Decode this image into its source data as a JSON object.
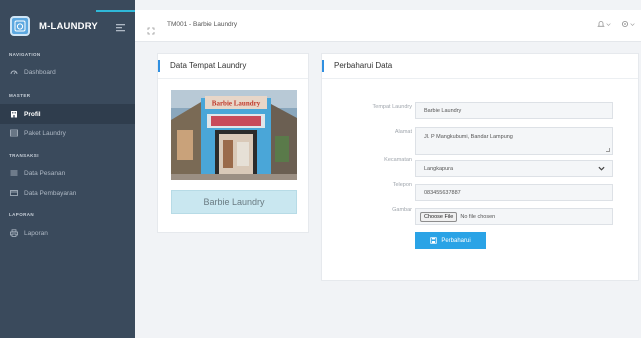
{
  "app": {
    "brand": "M-LAUNDRY"
  },
  "sidebar": {
    "sections": {
      "navigation": "NAVIGATION",
      "master": "MASTER",
      "transaksi": "TRANSAKSI",
      "laporan": "LAPORAN"
    },
    "items": [
      {
        "label": "Dashboard",
        "icon": "dashboard-icon"
      },
      {
        "label": "Profil",
        "icon": "building-icon",
        "active": true
      },
      {
        "label": "Paket Laundry",
        "icon": "table-icon"
      },
      {
        "label": "Data Pesanan",
        "icon": "list-icon"
      },
      {
        "label": "Data Pembayaran",
        "icon": "card-icon"
      },
      {
        "label": "Laporan",
        "icon": "print-icon"
      }
    ]
  },
  "header": {
    "breadcrumb": "TM001 - Barbie Laundry"
  },
  "left_card": {
    "title": "Data Tempat Laundry",
    "laundry_name": "Barbie Laundry",
    "photo_sign_text": "Barbie Laundry"
  },
  "right_card": {
    "title": "Perbaharui Data",
    "fields": {
      "tempat_label": "Tempat Laundry",
      "tempat_value": "Barbie Laundry",
      "alamat_label": "Alamat",
      "alamat_value": "Jl. P Mangkubumi, Bandar Lampung",
      "kecamatan_label": "Kecamatan",
      "kecamatan_value": "Langkapura",
      "telepon_label": "Telepon",
      "telepon_value": "083455637887",
      "gambar_label": "Gambar",
      "file_button": "Choose File",
      "file_status": "No file chosen"
    },
    "submit_label": "Perbaharui"
  },
  "colors": {
    "sidebar": "#3a4a5c",
    "sidebar_active": "#2f3d4d",
    "accent": "#2aa3e6",
    "title_bar": "#2f8fe0",
    "name_box": "#c9e7f0"
  }
}
